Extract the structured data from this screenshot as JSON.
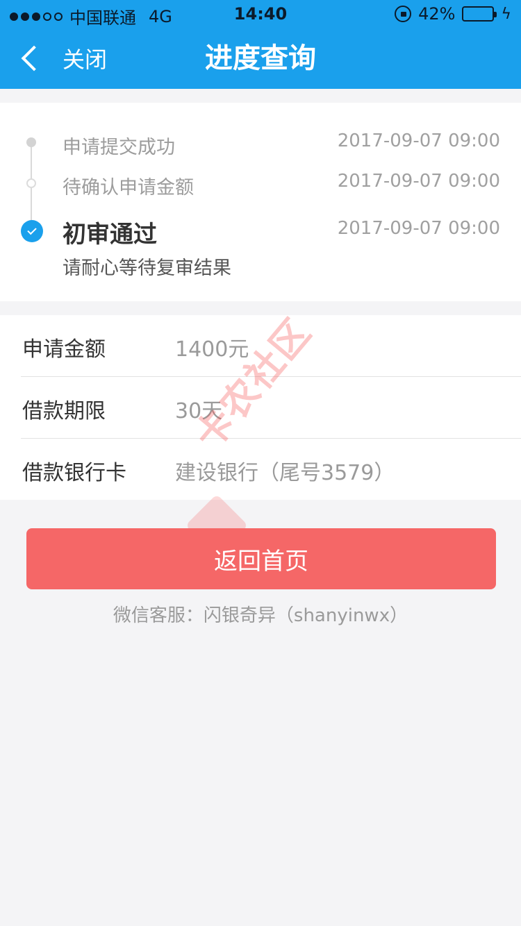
{
  "status_bar": {
    "carrier": "中国联通",
    "network": "4G",
    "time": "14:40",
    "battery_percent": "42%",
    "battery_level": 0.42
  },
  "nav": {
    "back_label": "关闭",
    "title": "进度查询"
  },
  "timeline": {
    "steps": [
      {
        "title": "申请提交成功",
        "time": "2017-09-07 09:00",
        "state": "done"
      },
      {
        "title": "待确认申请金额",
        "time": "2017-09-07 09:00",
        "state": "done"
      },
      {
        "title": "初审通过",
        "time": "2017-09-07 09:00",
        "state": "current",
        "subtitle": "请耐心等待复审结果"
      }
    ]
  },
  "info": {
    "rows": [
      {
        "label": "申请金额",
        "value": "1400元"
      },
      {
        "label": "借款期限",
        "value": "30天"
      },
      {
        "label": "借款银行卡",
        "value": "建设银行（尾号3579）"
      }
    ]
  },
  "watermark": "卡农社区",
  "actions": {
    "home_label": "返回首页"
  },
  "service_text": "微信客服：闪银奇异（shanyinwx）",
  "colors": {
    "primary": "#1aa0ec",
    "button": "#f56767",
    "background": "#f4f4f6"
  }
}
